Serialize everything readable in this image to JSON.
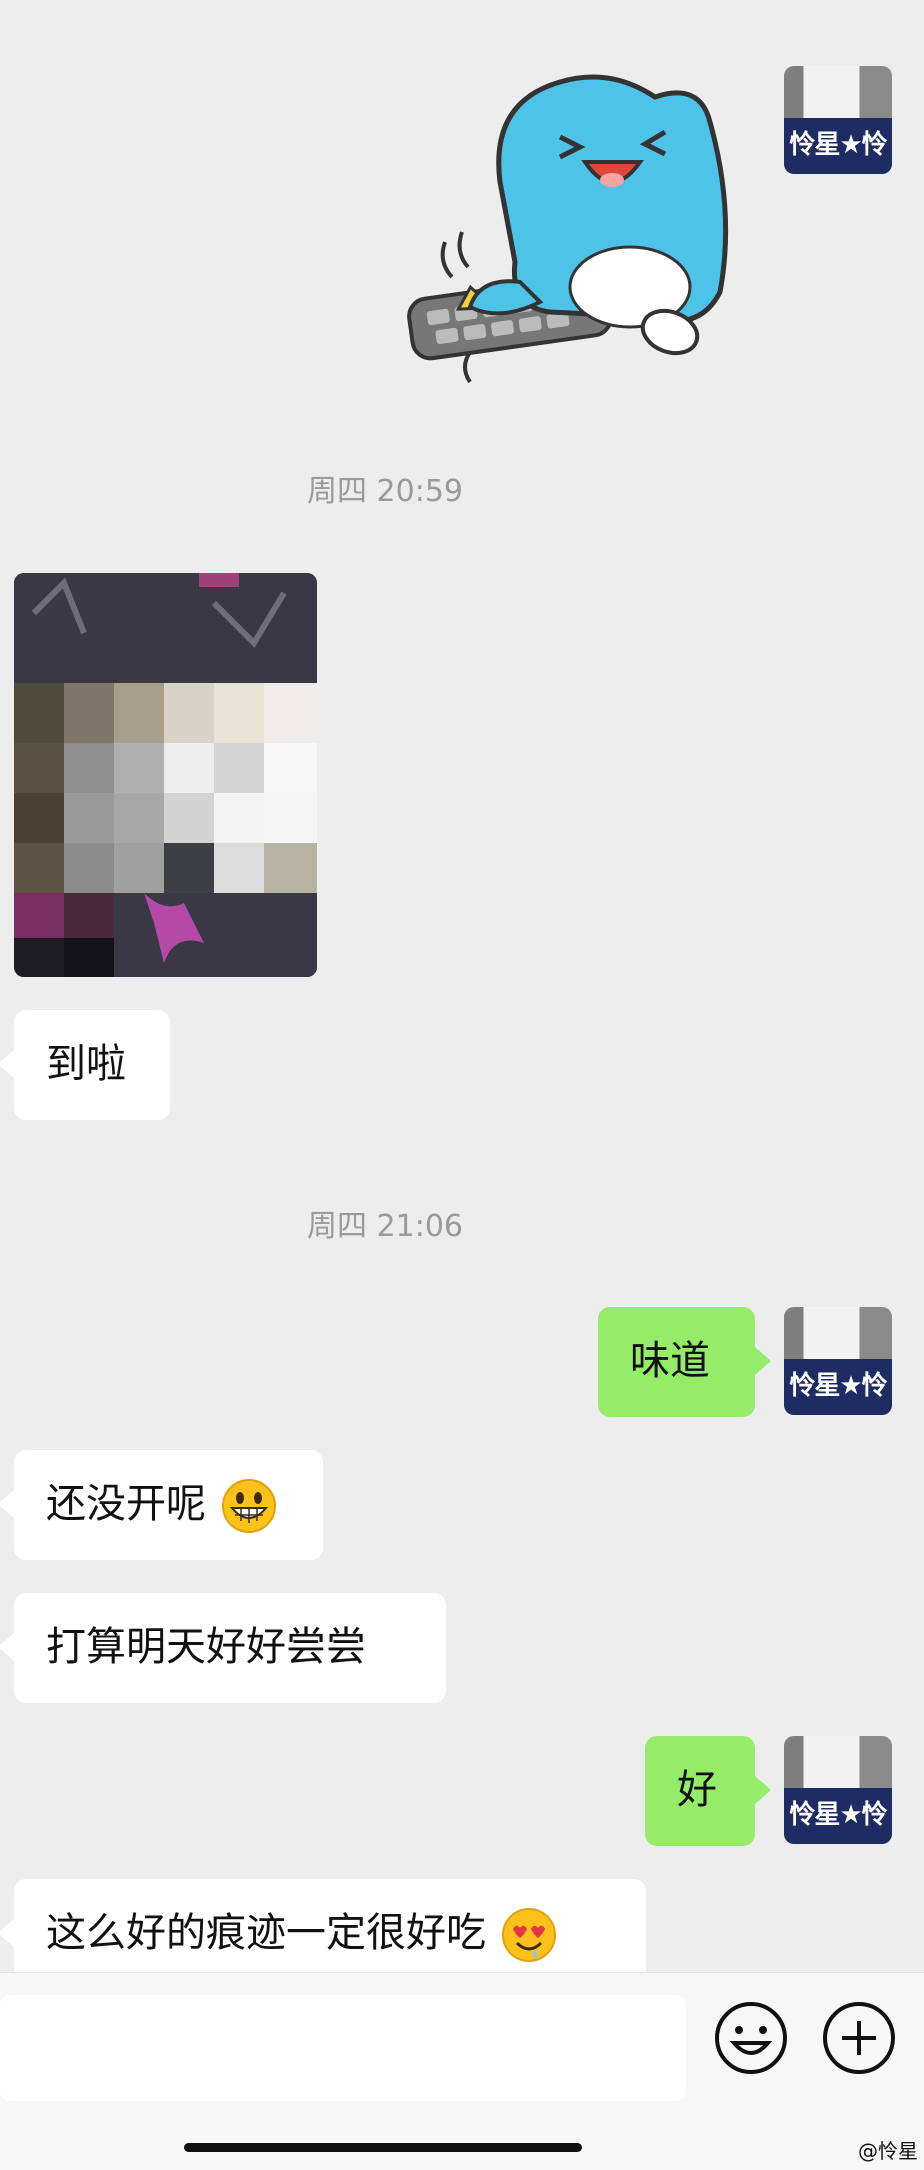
{
  "avatar_label": "怜星★怜",
  "timestamps": [
    "周四 20:59",
    "周四 21:06"
  ],
  "messages": {
    "m1": "到啦",
    "m2": "味道",
    "m3": "还没开呢",
    "m4": "打算明天好好尝尝",
    "m5": "好",
    "m6": "这么好的痕迹一定很好吃"
  },
  "emojis": {
    "grin": "grinning-emoji",
    "heart_eyes": "heart-eyes-drool-emoji"
  },
  "sticker": "blue-cat-typing-keyboard-sticker",
  "input": {
    "value": "",
    "placeholder": ""
  },
  "footer_watermark": "@怜星",
  "colors": {
    "background": "#ededed",
    "sent_bubble": "#95ec69",
    "received_bubble": "#ffffff"
  }
}
